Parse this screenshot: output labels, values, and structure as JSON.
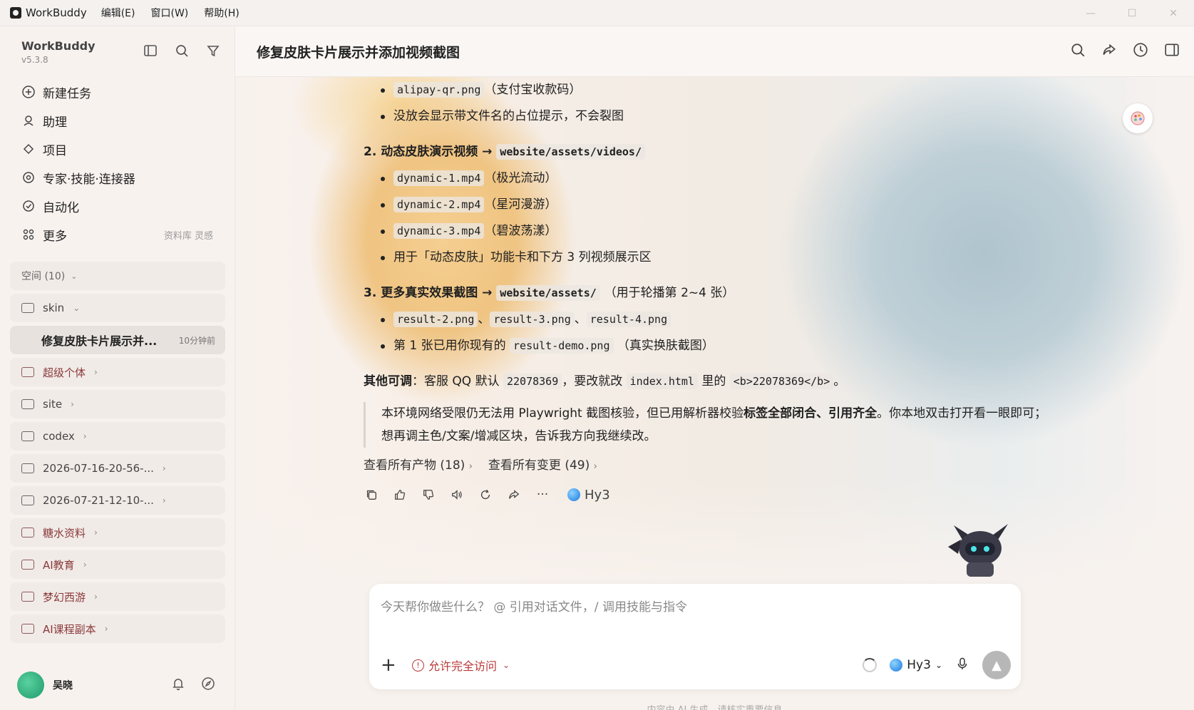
{
  "titlebar": {
    "app_name": "WorkBuddy",
    "menus": [
      "编辑(E)",
      "窗口(W)",
      "帮助(H)"
    ]
  },
  "sidebar": {
    "title": "WorkBuddy",
    "version": "v5.3.8",
    "nav": [
      {
        "label": "新建任务",
        "icon": "plus-circle-icon"
      },
      {
        "label": "助理",
        "icon": "assistant-icon"
      },
      {
        "label": "项目",
        "icon": "project-icon"
      },
      {
        "label": "专家·技能·连接器",
        "icon": "expert-icon"
      },
      {
        "label": "自动化",
        "icon": "automation-icon"
      },
      {
        "label": "更多",
        "icon": "more-grid-icon",
        "extra": "资料库 灵感"
      }
    ],
    "spaces_header": "空间 (10)",
    "folders": [
      {
        "label": "skin",
        "chevron": "⌄"
      },
      {
        "label": "超级个体",
        "chevron": "›",
        "colored": true
      },
      {
        "label": "site",
        "chevron": "›"
      },
      {
        "label": "codex",
        "chevron": "›"
      },
      {
        "label": "2026-07-16-20-56-...",
        "chevron": "›"
      },
      {
        "label": "2026-07-21-12-10-...",
        "chevron": "›"
      },
      {
        "label": "糖水资料",
        "chevron": "›",
        "colored": true
      },
      {
        "label": "AI教育",
        "chevron": "›",
        "colored": true
      },
      {
        "label": "梦幻西游",
        "chevron": "›",
        "colored": true
      },
      {
        "label": "AI课程副本",
        "chevron": "›",
        "colored": true
      }
    ],
    "active_task": {
      "label": "修复皮肤卡片展示并...",
      "time": "10分钟前"
    },
    "user_name": "吴晓"
  },
  "main": {
    "title": "修复皮肤卡片展示并添加视频截图",
    "content": {
      "b1_code": "alipay-qr.png",
      "b1_text": "（支付宝收款码）",
      "b2_text": "没放会显示带文件名的占位提示，不会裂图",
      "s2_label": "2. 动态皮肤演示视频 →",
      "s2_code": "website/assets/videos/",
      "v1_code": "dynamic-1.mp4",
      "v1_text": "（极光流动）",
      "v2_code": "dynamic-2.mp4",
      "v2_text": "（星河漫游）",
      "v3_code": "dynamic-3.mp4",
      "v3_text": "（碧波荡漾）",
      "v4_text": "用于「动态皮肤」功能卡和下方 3 列视频展示区",
      "s3_label": "3. 更多真实效果截图 →",
      "s3_code": "website/assets/",
      "s3_paren": "（用于轮播第 2~4 张）",
      "r1_code1": "result-2.png",
      "r1_sep1": "、",
      "r1_code2": "result-3.png",
      "r1_sep2": "、",
      "r1_code3": "result-4.png",
      "r2_text1": "第 1 张已用你现有的",
      "r2_code": "result-demo.png",
      "r2_text2": "（真实换肤截图）",
      "other_label": "其他可调",
      "other_text1": "：客服 QQ 默认",
      "other_code1": "22078369",
      "other_text2": "，要改就改",
      "other_code2": "index.html",
      "other_text3": "里的",
      "other_code3": "<b>22078369</b>",
      "other_text4": "。",
      "note_text1": "本环境网络受限仍无法用 Playwright 截图核验，但已用解析器校验",
      "note_bold1": "标签全部闭合、引用齐全",
      "note_text2": "。你本地双击打开看一眼即可；想再调主色/文案/增减区块，告诉我方向我继续改。",
      "link_artifacts": "查看所有产物 (18)",
      "link_changes": "查看所有变更 (49)",
      "model": "Hy3"
    },
    "composer": {
      "placeholder": "今天帮你做些什么？ @ 引用对话文件，/ 调用技能与指令",
      "access": "允许完全访问",
      "model": "Hy3"
    },
    "disclaimer": "内容由 AI 生成，请核实重要信息"
  },
  "colors": {
    "accent_red": "#b83a3a",
    "send_button": "#b7b7b7"
  }
}
